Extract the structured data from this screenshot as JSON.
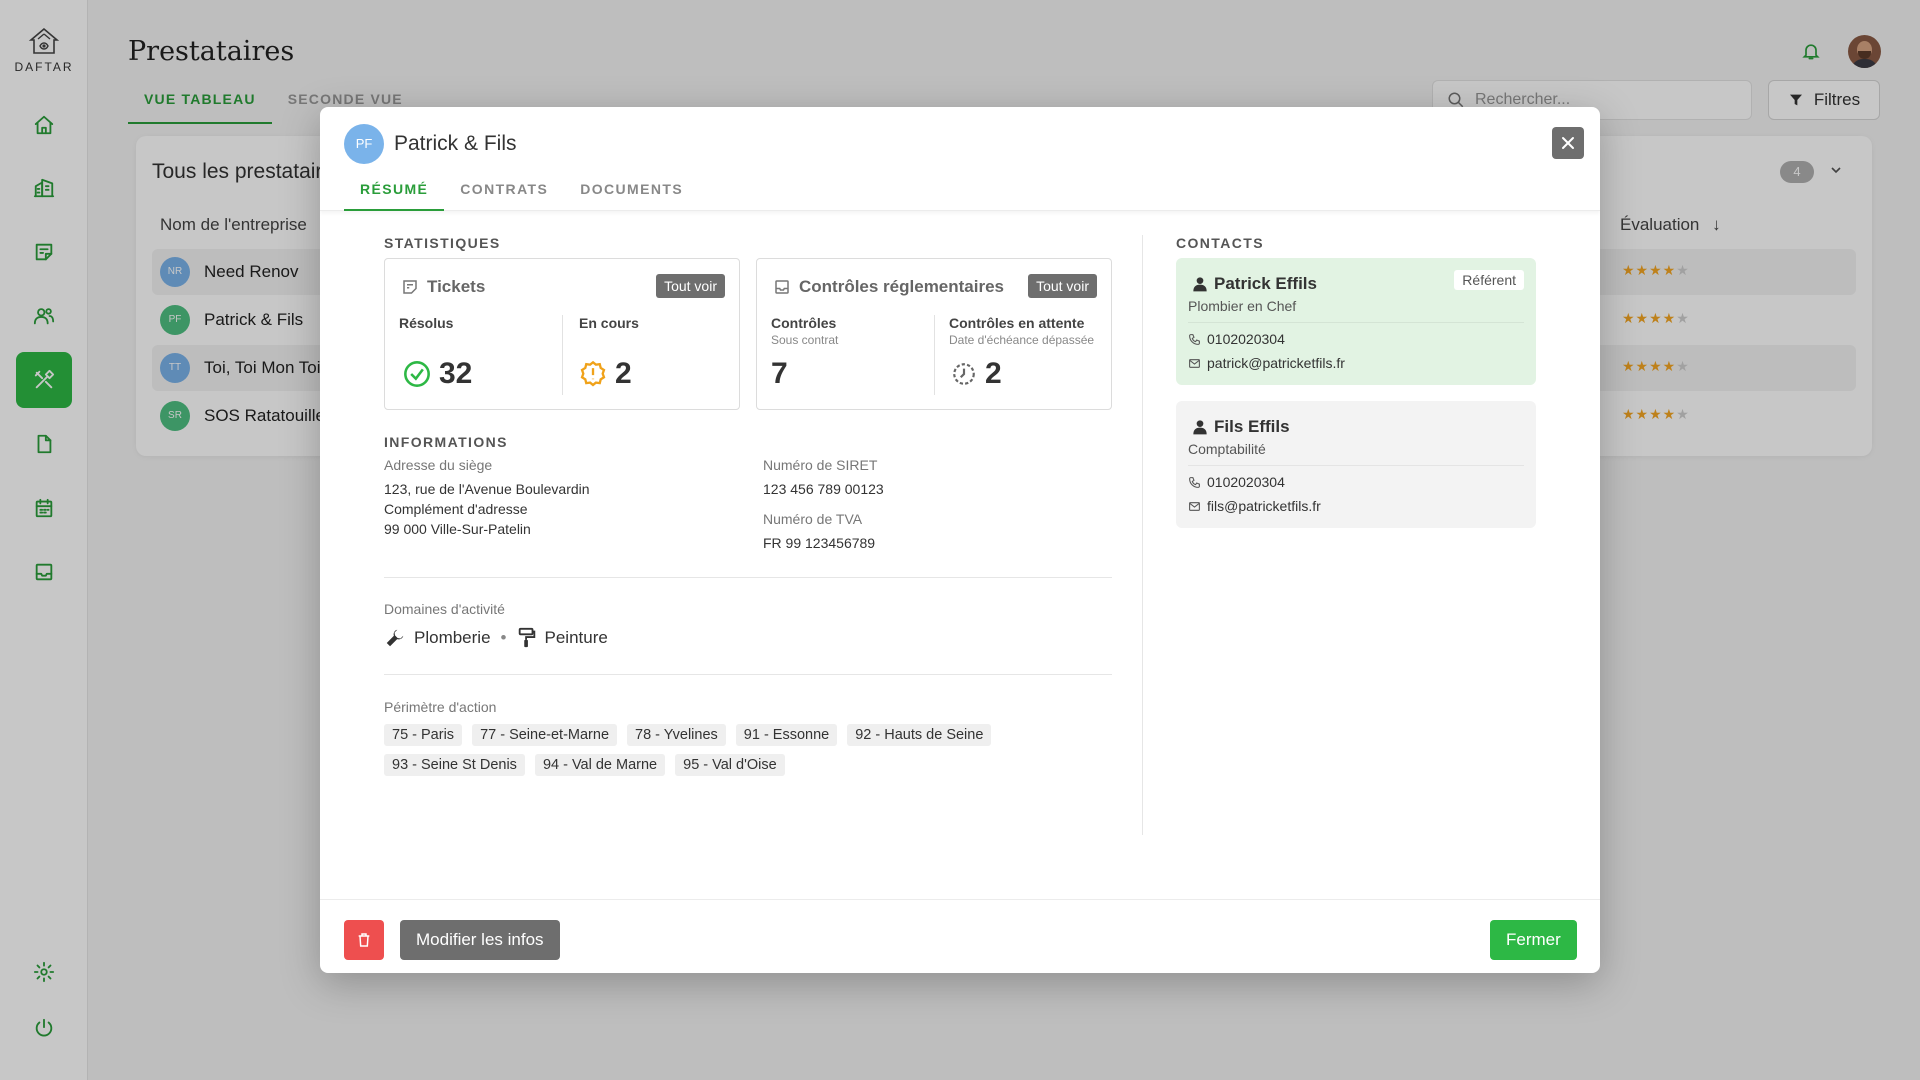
{
  "app": {
    "logo_text": "DAFTAR"
  },
  "sidebar": {
    "items": [
      {
        "icon": "home-icon",
        "active": false
      },
      {
        "icon": "buildings-icon",
        "active": false
      },
      {
        "icon": "ticket-icon",
        "active": false
      },
      {
        "icon": "users-icon",
        "active": false
      },
      {
        "icon": "tools-icon",
        "active": true
      },
      {
        "icon": "file-icon",
        "active": false
      },
      {
        "icon": "calendar-icon",
        "active": false
      },
      {
        "icon": "inbox-icon",
        "active": false
      }
    ],
    "bottom": [
      {
        "icon": "gear-icon"
      },
      {
        "icon": "power-icon"
      }
    ]
  },
  "header": {
    "title": "Prestataires",
    "tabs": [
      {
        "label": "VUE TABLEAU",
        "active": true
      },
      {
        "label": "SECONDE VUE",
        "active": false
      }
    ],
    "search_placeholder": "Rechercher...",
    "filters_label": "Filtres"
  },
  "list": {
    "title": "Tous les prestataires",
    "count": "4",
    "columns": {
      "name": "Nom de l'entreprise",
      "rating": "Évaluation"
    },
    "rows": [
      {
        "initials": "NR",
        "name": "Need Renov",
        "color": "#7ab3ea",
        "rating": 4
      },
      {
        "initials": "PF",
        "name": "Patrick & Fils",
        "color": "#4fbf82",
        "rating": 4
      },
      {
        "initials": "TT",
        "name": "Toi, Toi Mon Toit",
        "color": "#7ab3ea",
        "rating": 4
      },
      {
        "initials": "SR",
        "name": "SOS Ratatouille",
        "color": "#4fbf82",
        "rating": 4
      }
    ]
  },
  "modal": {
    "initials": "PF",
    "title": "Patrick & Fils",
    "tabs": [
      {
        "label": "RÉSUMÉ",
        "active": true
      },
      {
        "label": "CONTRATS",
        "active": false
      },
      {
        "label": "DOCUMENTS",
        "active": false
      }
    ],
    "stats": {
      "title": "STATISTIQUES",
      "tickets": {
        "title": "Tickets",
        "see_all": "Tout voir",
        "resolved_label": "Résolus",
        "resolved_value": "32",
        "ongoing_label": "En cours",
        "ongoing_value": "2"
      },
      "controls": {
        "title": "Contrôles réglementaires",
        "see_all": "Tout voir",
        "contract_label": "Contrôles",
        "contract_sub": "Sous contrat",
        "contract_value": "7",
        "pending_label": "Contrôles en attente",
        "pending_sub": "Date d'échéance dépassée",
        "pending_value": "2"
      }
    },
    "info": {
      "title": "INFORMATIONS",
      "address_label": "Adresse du siège",
      "address_line1": "123, rue de l'Avenue Boulevardin",
      "address_line2": "Complément d'adresse",
      "address_line3": "99 000 Ville-Sur-Patelin",
      "siret_label": "Numéro de SIRET",
      "siret": "123 456 789 00123",
      "tva_label": "Numéro de TVA",
      "tva": "FR 99 123456789"
    },
    "domains": {
      "label": "Domaines d'activité",
      "items": [
        {
          "label": "Plomberie",
          "icon": "wrench-icon"
        },
        {
          "label": "Peinture",
          "icon": "paint-roller-icon"
        }
      ]
    },
    "perimeter": {
      "label": "Périmètre d'action",
      "chips": [
        "75 - Paris",
        "77 - Seine-et-Marne",
        "78 - Yvelines",
        "91 - Essonne",
        "92 - Hauts de Seine",
        "93 - Seine St Denis",
        "94 - Val de Marne",
        "95 - Val d'Oise"
      ]
    },
    "contacts": {
      "title": "CONTACTS",
      "items": [
        {
          "name": "Patrick Effils",
          "role": "Plombier en Chef",
          "badge": "Référent",
          "phone": "0102020304",
          "email": "patrick@patricketfils.fr"
        },
        {
          "name": "Fils Effils",
          "role": "Comptabilité",
          "phone": "0102020304",
          "email": "fils@patricketfils.fr"
        }
      ]
    },
    "footer": {
      "edit_label": "Modifier les infos",
      "close_label": "Fermer"
    }
  }
}
